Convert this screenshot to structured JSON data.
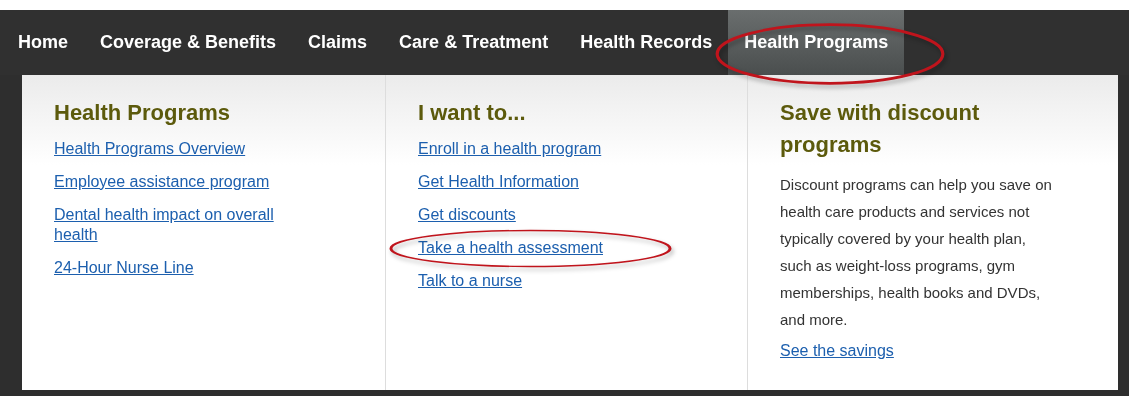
{
  "nav": [
    {
      "label": "Home",
      "selected": false,
      "highlighted": false
    },
    {
      "label": "Coverage & Benefits",
      "selected": false,
      "highlighted": false
    },
    {
      "label": "Claims",
      "selected": false,
      "highlighted": false
    },
    {
      "label": "Care & Treatment",
      "selected": false,
      "highlighted": false
    },
    {
      "label": "Health Records",
      "selected": false,
      "highlighted": false
    },
    {
      "label": "Health Programs",
      "selected": true,
      "highlighted": true
    }
  ],
  "columns": [
    {
      "kind": "links",
      "heading": "Health Programs",
      "links": [
        {
          "label": "Health Programs Overview",
          "highlighted": false
        },
        {
          "label": "Employee assistance program",
          "highlighted": false
        },
        {
          "label": "Dental health impact on overall health",
          "highlighted": false
        },
        {
          "label": "24-Hour Nurse Line",
          "highlighted": false
        }
      ]
    },
    {
      "kind": "links",
      "heading": "I want to...",
      "links": [
        {
          "label": "Enroll in a health program",
          "highlighted": false
        },
        {
          "label": "Get Health Information",
          "highlighted": false
        },
        {
          "label": "Get discounts",
          "highlighted": false
        },
        {
          "label": "Take a health assessment",
          "highlighted": true
        },
        {
          "label": "Talk to a nurse",
          "highlighted": false
        }
      ]
    },
    {
      "kind": "promo",
      "heading": "Save with discount programs",
      "text": "Discount programs can help you save on health care products and services not typically covered by your health plan, such as weight-loss programs, gym memberships, health books and DVDs, and more.",
      "link": "See the savings"
    }
  ]
}
